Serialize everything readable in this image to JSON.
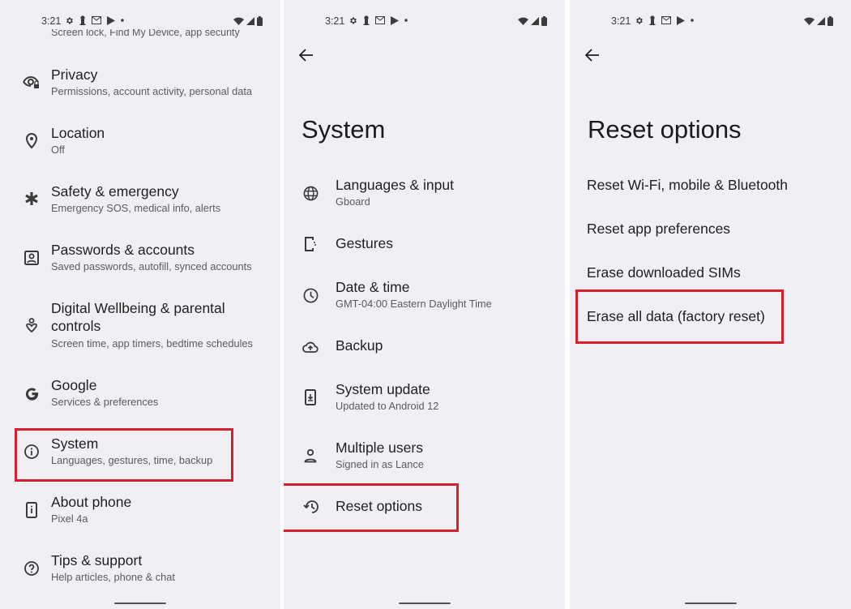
{
  "status_bar": {
    "time": "3:21",
    "left_icons": [
      "settings-icon",
      "keyhole-icon",
      "gmail-icon",
      "play-store-icon",
      "dot-icon"
    ],
    "right_icons": [
      "wifi-icon",
      "signal-icon",
      "battery-icon"
    ]
  },
  "panel1": {
    "cutoff_text": "Screen lock, Find My Device, app security",
    "items": [
      {
        "icon": "privacy-eye-icon",
        "title": "Privacy",
        "subtitle": "Permissions, account activity, personal data"
      },
      {
        "icon": "location-pin-icon",
        "title": "Location",
        "subtitle": "Off"
      },
      {
        "icon": "asterisk-emergency-icon",
        "title": "Safety & emergency",
        "subtitle": "Emergency SOS, medical info, alerts"
      },
      {
        "icon": "account-box-icon",
        "title": "Passwords & accounts",
        "subtitle": "Saved passwords, autofill, synced accounts"
      },
      {
        "icon": "wellbeing-icon",
        "title": "Digital Wellbeing & parental",
        "title_line2": "controls",
        "subtitle": "Screen time, app timers, bedtime schedules"
      },
      {
        "icon": "google-g-icon",
        "title": "Google",
        "subtitle": "Services & preferences"
      },
      {
        "icon": "info-circle-icon",
        "title": "System",
        "subtitle": "Languages, gestures, time, backup",
        "highlighted": true
      },
      {
        "icon": "phone-info-icon",
        "title": "About phone",
        "subtitle": "Pixel 4a"
      },
      {
        "icon": "help-circle-icon",
        "title": "Tips & support",
        "subtitle": "Help articles, phone & chat"
      }
    ]
  },
  "panel2": {
    "page_title": "System",
    "items": [
      {
        "icon": "globe-icon",
        "title": "Languages & input",
        "subtitle": "Gboard"
      },
      {
        "icon": "gestures-phone-icon",
        "title": "Gestures",
        "subtitle": ""
      },
      {
        "icon": "clock-icon",
        "title": "Date & time",
        "subtitle": "GMT-04:00 Eastern Daylight Time"
      },
      {
        "icon": "cloud-upload-icon",
        "title": "Backup",
        "subtitle": ""
      },
      {
        "icon": "system-update-icon",
        "title": "System update",
        "subtitle": "Updated to Android 12"
      },
      {
        "icon": "person-icon",
        "title": "Multiple users",
        "subtitle": "Signed in as Lance"
      },
      {
        "icon": "history-icon",
        "title": "Reset options",
        "subtitle": "",
        "highlighted": true
      }
    ]
  },
  "panel3": {
    "page_title": "Reset options",
    "items": [
      {
        "title": "Reset Wi-Fi, mobile & Bluetooth"
      },
      {
        "title": "Reset app preferences"
      },
      {
        "title": "Erase downloaded SIMs"
      },
      {
        "title": "Erase all data (factory reset)",
        "highlighted": true
      }
    ]
  },
  "colors": {
    "background": "#f0eff4",
    "highlight_box": "#d7202e",
    "text_primary": "#1f1f1f",
    "text_secondary": "#5b5b5b"
  }
}
